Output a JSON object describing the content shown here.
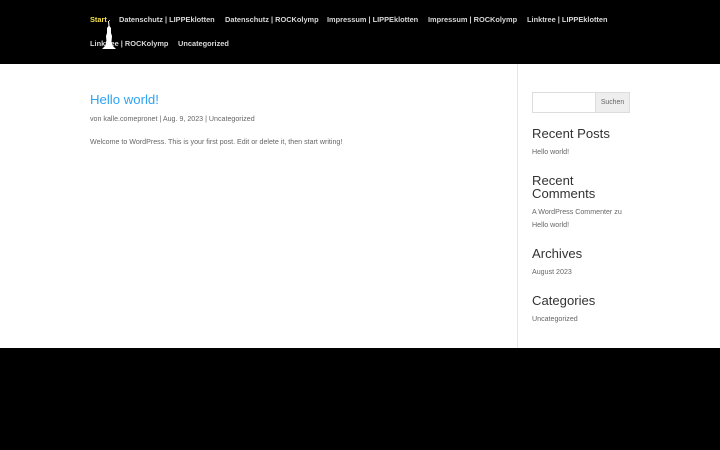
{
  "nav": {
    "items": [
      {
        "label": "Start"
      },
      {
        "label": "Datenschutz | LIPPEklotten"
      },
      {
        "label": "Datenschutz | ROCKolymp"
      },
      {
        "label": "Impressum | LIPPEklotten"
      },
      {
        "label": "Impressum | ROCKolymp"
      },
      {
        "label": "Linktree | LIPPEklotten"
      },
      {
        "label": "Linktree | ROCKolymp"
      },
      {
        "label": "Uncategorized"
      }
    ]
  },
  "logo": {
    "icon": "statue-logo-icon"
  },
  "post": {
    "title": "Hello world!",
    "meta": {
      "prefix": "von",
      "author": "kalle.comepronet",
      "sep1": "|",
      "date": "Aug. 9, 2023",
      "sep2": "|",
      "category": "Uncategorized"
    },
    "excerpt": "Welcome to WordPress. This is your first post. Edit or delete it, then start writing!"
  },
  "sidebar": {
    "search": {
      "placeholder": "",
      "value": "",
      "button": "Suchen"
    },
    "recent_posts": {
      "title": "Recent Posts",
      "items": [
        "Hello world!"
      ]
    },
    "recent_comments": {
      "title_line1": "Recent",
      "title_line2": "Comments",
      "author": "A WordPress Commenter",
      "on": "zu",
      "post": "Hello world!"
    },
    "archives": {
      "title": "Archives",
      "items": [
        "August 2023"
      ]
    },
    "categories": {
      "title": "Categories",
      "items": [
        "Uncategorized"
      ]
    }
  },
  "colors": {
    "header_bg": "#000000",
    "active_nav": "#f6e24a",
    "nav_text": "#d8d8d8",
    "link": "#2ea3f2",
    "body_text": "#666666",
    "heading": "#333333"
  }
}
